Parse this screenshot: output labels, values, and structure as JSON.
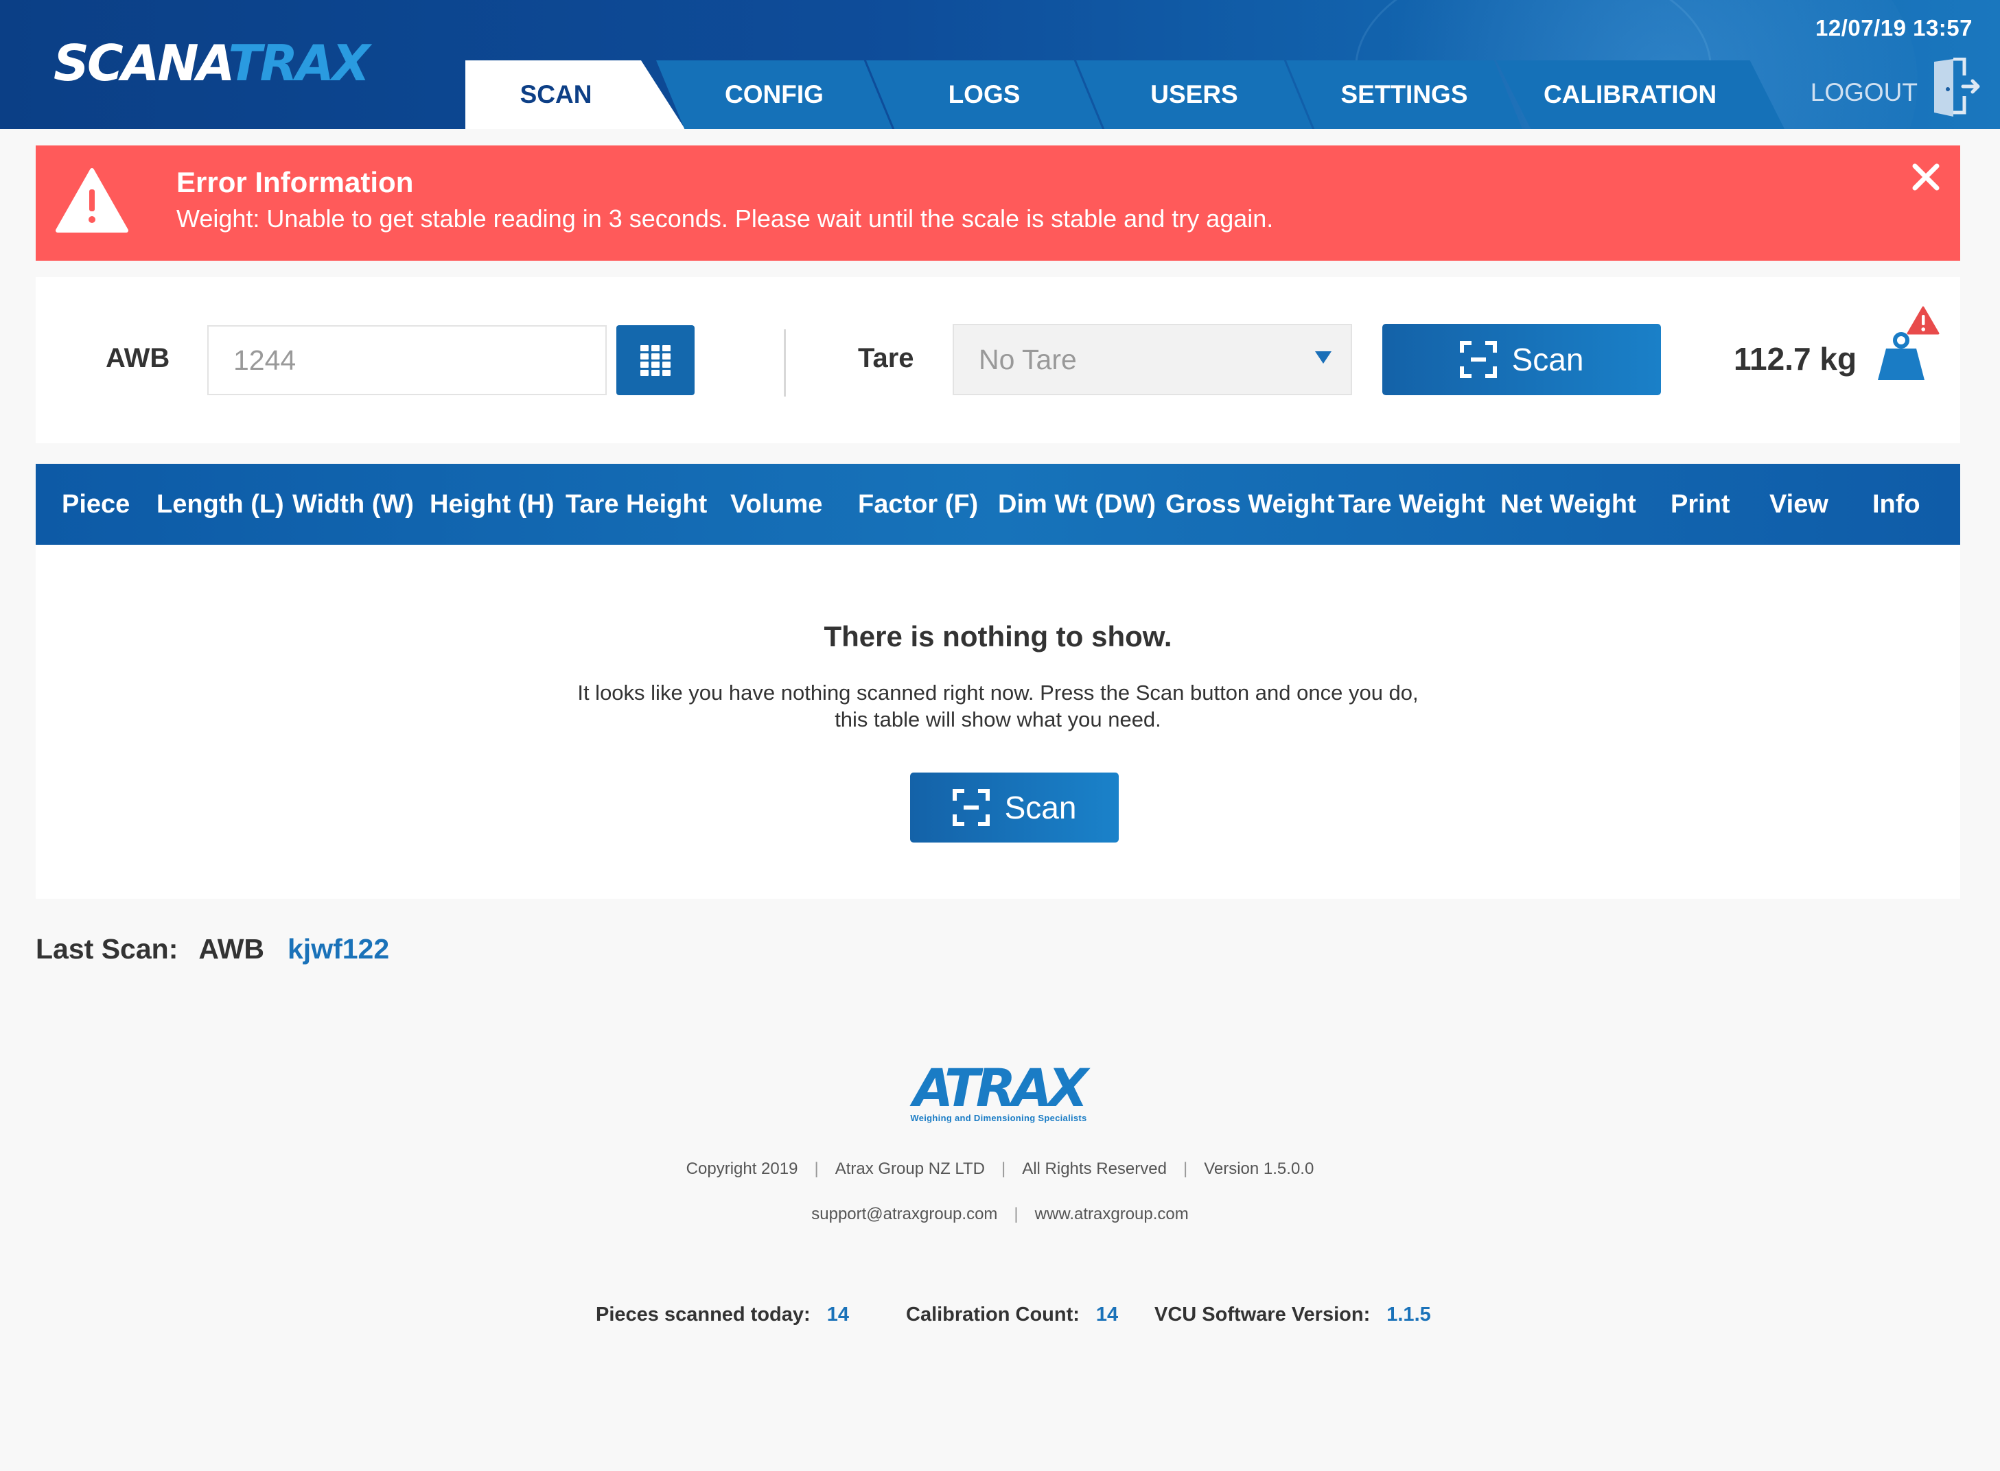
{
  "app": {
    "logo_part1": "SCANA",
    "logo_part2": "TRAX",
    "datetime": "12/07/19 13:57",
    "logout_label": "LOGOUT"
  },
  "nav": {
    "tabs": [
      {
        "label": "SCAN",
        "active": true
      },
      {
        "label": "CONFIG",
        "active": false
      },
      {
        "label": "LOGS",
        "active": false
      },
      {
        "label": "USERS",
        "active": false
      },
      {
        "label": "SETTINGS",
        "active": false
      },
      {
        "label": "CALIBRATION",
        "active": false
      }
    ]
  },
  "error": {
    "title": "Error Information",
    "message": "Weight:  Unable to get stable reading in 3 seconds. Please wait until the scale is stable and try again."
  },
  "scan_form": {
    "awb_label": "AWB",
    "awb_value": "1244",
    "tare_label": "Tare",
    "tare_selected": "No Tare",
    "scan_button": "Scan",
    "weight": "112.7 kg"
  },
  "table": {
    "columns": [
      "Piece",
      "Length (L)",
      "Width (W)",
      "Height (H)",
      "Tare Height",
      "Volume",
      "Factor (F)",
      "Dim Wt (DW)",
      "Gross Weight",
      "Tare Weight",
      "Net Weight",
      "Print",
      "View",
      "Info"
    ],
    "rows": [],
    "empty_title": "There is nothing to show.",
    "empty_line1": "It looks like you have nothing scanned right now.  Press the Scan button and once you do,",
    "empty_line2": "this table will show what you need.",
    "empty_scan_button": "Scan"
  },
  "last_scan": {
    "label": "Last Scan:",
    "type": "AWB",
    "value": "kjwf122"
  },
  "footer": {
    "company_logo": "ATRAX",
    "tagline": "Weighing and Dimensioning Specialists",
    "copyright": "Copyright 2019",
    "company": "Atrax Group NZ LTD",
    "rights": "All Rights Reserved",
    "version": "Version 1.5.0.0",
    "email": "support@atraxgroup.com",
    "website": "www.atraxgroup.com"
  },
  "stats": {
    "pieces_label": "Pieces scanned today:",
    "pieces_value": "14",
    "calibration_label": "Calibration Count:",
    "calibration_value": "14",
    "vcu_label": "VCU Software Version:",
    "vcu_value": "1.1.5"
  },
  "colors": {
    "header_dark": "#0b3f86",
    "accent_blue": "#1a72b9",
    "error_red": "#ff5a5a",
    "button_blue": "#1468ad"
  },
  "icons": [
    "warning-triangle-icon",
    "close-icon",
    "keypad-grid-icon",
    "scan-frame-icon",
    "weight-alert-icon",
    "logout-door-icon",
    "dropdown-arrow-icon"
  ]
}
